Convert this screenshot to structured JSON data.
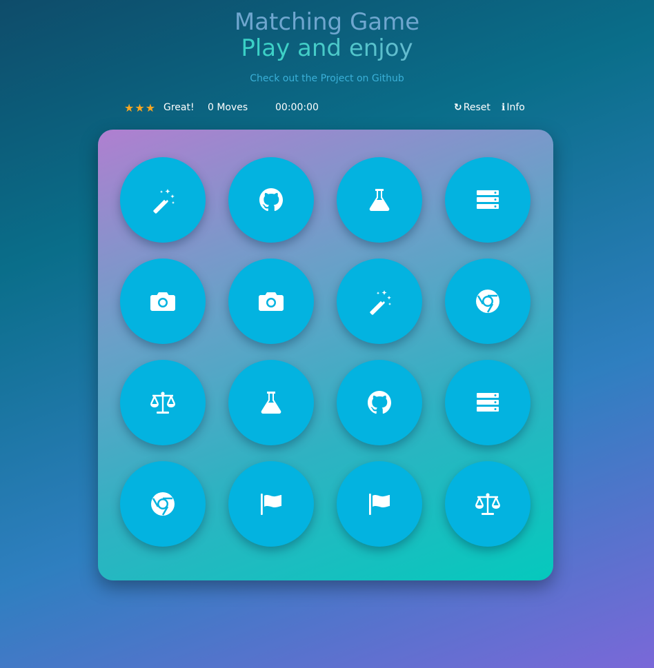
{
  "header": {
    "title_line1": "Matching Game",
    "title_line2": "Play and enjoy",
    "github_link": "Check out the Project on Github"
  },
  "stats": {
    "stars": "★★★",
    "star_count": 3,
    "rating_text": "Great!",
    "moves": "0 Moves",
    "timer": "00:00:00",
    "reset_label": "Reset",
    "info_label": "Info"
  },
  "colors": {
    "card": "#03b3e0",
    "star": "#f5a623"
  },
  "cards": [
    {
      "icon": "magic-wand-icon"
    },
    {
      "icon": "github-icon"
    },
    {
      "icon": "flask-icon"
    },
    {
      "icon": "server-icon"
    },
    {
      "icon": "camera-icon"
    },
    {
      "icon": "camera-icon"
    },
    {
      "icon": "magic-wand-icon"
    },
    {
      "icon": "chrome-icon"
    },
    {
      "icon": "balance-scale-icon"
    },
    {
      "icon": "flask-icon"
    },
    {
      "icon": "github-icon"
    },
    {
      "icon": "server-icon"
    },
    {
      "icon": "chrome-icon"
    },
    {
      "icon": "flag-icon"
    },
    {
      "icon": "flag-icon"
    },
    {
      "icon": "balance-scale-icon"
    }
  ]
}
